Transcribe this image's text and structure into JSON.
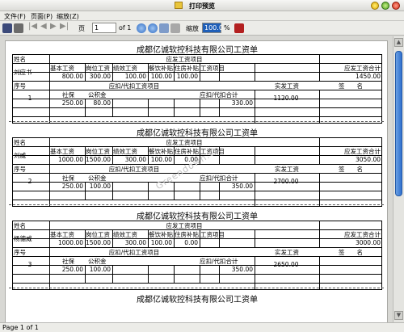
{
  "window": {
    "title": "打印预览",
    "icon_color": "#e9c53b"
  },
  "menu": [
    "文件(F)",
    "页面(P)",
    "缩放(Z)"
  ],
  "toolbar": {
    "page_label": "页",
    "page_value": "1",
    "of_label": "of 1",
    "zoom_label": "缩放",
    "zoom_value": "100.0",
    "percent_label": "%"
  },
  "status": "Page 1 of 1",
  "watermark": "Greendown.cn",
  "labels": {
    "name": "姓名",
    "payable_items": "应发工资项目",
    "base": "基本工资",
    "post": "岗位工资",
    "perf": "绩效工资",
    "meal": "餐饮补贴",
    "housing": "住房补贴",
    "overtime": "工资项目",
    "payable_total": "应发工资合计",
    "seq": "序号",
    "deduct_items": "应扣/代扣工资项目",
    "actual": "实发工资",
    "sign": "签　　名",
    "social": "社保",
    "fund": "公积金",
    "deduct_total": "应扣/代扣合计"
  },
  "slips": [
    {
      "company": "成都亿诚软控科技有限公司工资单",
      "name": "刘应书",
      "seq": "1",
      "base": "800.00",
      "post": "300.00",
      "perf": "100.00",
      "meal": "100.00",
      "housing": "100.00",
      "overtime": "",
      "payable_total": "1450.00",
      "social": "250.00",
      "fund": "80.00",
      "deduct_total": "330.00",
      "actual": "1120.00"
    },
    {
      "company": "成都亿诚软控科技有限公司工资单",
      "name": "刘威",
      "seq": "2",
      "base": "1000.00",
      "post": "1500.00",
      "perf": "300.00",
      "meal": "100.00",
      "housing": "0.00",
      "overtime": "",
      "payable_total": "3050.00",
      "social": "250.00",
      "fund": "100.00",
      "deduct_total": "350.00",
      "actual": "2700.00"
    },
    {
      "company": "成都亿诚软控科技有限公司工资单",
      "name": "杨德威",
      "seq": "3",
      "base": "1000.00",
      "post": "1500.00",
      "perf": "300.00",
      "meal": "100.00",
      "housing": "0.00",
      "overtime": "",
      "payable_total": "3000.00",
      "social": "250.00",
      "fund": "100.00",
      "deduct_total": "350.00",
      "actual": "2650.00"
    },
    {
      "company": "成都亿诚软控科技有限公司工资单"
    }
  ]
}
